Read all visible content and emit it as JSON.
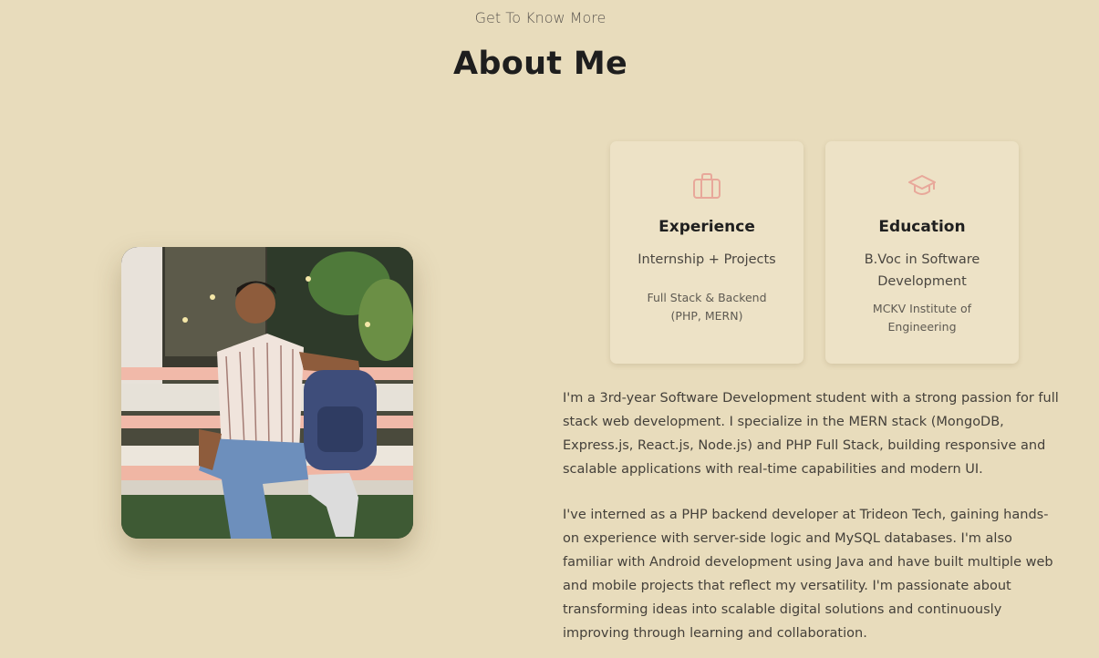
{
  "header": {
    "subtitle": "Get To Know More",
    "title": "About Me"
  },
  "cards": {
    "experience": {
      "icon": "briefcase-icon",
      "title": "Experience",
      "main": "Internship + Projects",
      "sub": "Full Stack & Backend (PHP, MERN)"
    },
    "education": {
      "icon": "graduation-cap-icon",
      "title": "Education",
      "main": "B.Voc in Software Development",
      "sub": "MCKV Institute of Engineering"
    }
  },
  "bio": {
    "paragraph_1": "I'm a 3rd-year Software Development student with a strong passion for full stack web development. I specialize in the MERN stack (MongoDB, Express.js, React.js, Node.js) and PHP Full Stack, building responsive and scalable applications with real-time capabilities and modern UI.",
    "paragraph_2": "I've interned as a PHP backend developer at Trideon Tech, gaining hands-on experience with server-side logic and MySQL databases. I'm also familiar with Android development using Java and have built multiple web and mobile projects that reflect my versatility. I'm passionate about transforming ideas into scalable digital solutions and continuously improving through learning and collaboration."
  },
  "colors": {
    "background": "#e8dcbc",
    "card": "#ede2c6",
    "icon_accent": "#e8a89a"
  }
}
